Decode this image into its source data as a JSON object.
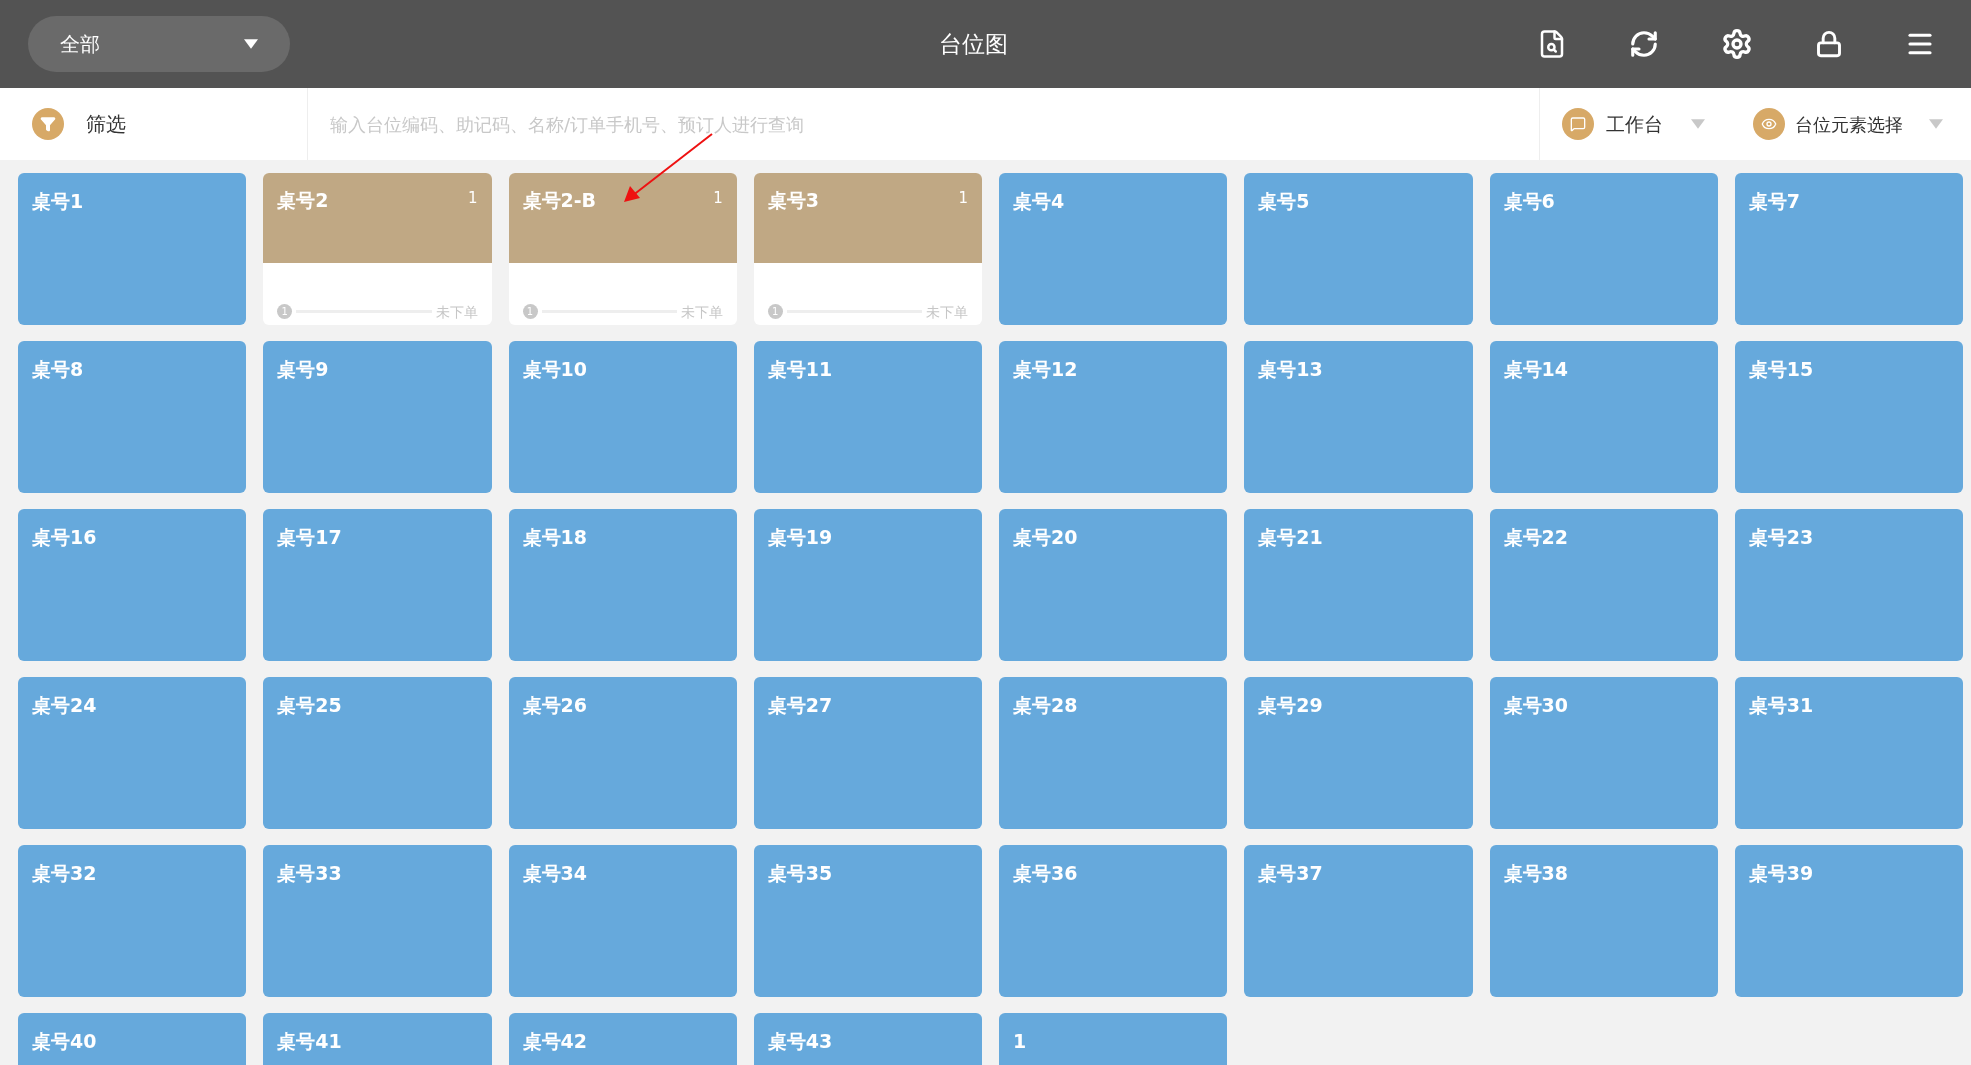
{
  "header": {
    "area_select": "全部",
    "title": "台位图"
  },
  "filter_bar": {
    "filter_label": "筛选",
    "search_placeholder": "输入台位编码、助记码、名称/订单手机号、预订人进行查询",
    "workbench": "工作台",
    "element_select": "台位元素选择"
  },
  "tables": [
    {
      "name": "桌号1",
      "kind": "free"
    },
    {
      "name": "桌号2",
      "kind": "occupied",
      "guests": "1",
      "step": "1",
      "status": "未下单"
    },
    {
      "name": "桌号2-B",
      "kind": "occupied",
      "guests": "1",
      "step": "1",
      "status": "未下单"
    },
    {
      "name": "桌号3",
      "kind": "occupied",
      "guests": "1",
      "step": "1",
      "status": "未下单"
    },
    {
      "name": "桌号4",
      "kind": "free"
    },
    {
      "name": "桌号5",
      "kind": "free"
    },
    {
      "name": "桌号6",
      "kind": "free"
    },
    {
      "name": "桌号7",
      "kind": "free"
    },
    {
      "name": "桌号8",
      "kind": "free"
    },
    {
      "name": "桌号9",
      "kind": "free"
    },
    {
      "name": "桌号10",
      "kind": "free"
    },
    {
      "name": "桌号11",
      "kind": "free"
    },
    {
      "name": "桌号12",
      "kind": "free"
    },
    {
      "name": "桌号13",
      "kind": "free"
    },
    {
      "name": "桌号14",
      "kind": "free"
    },
    {
      "name": "桌号15",
      "kind": "free"
    },
    {
      "name": "桌号16",
      "kind": "free"
    },
    {
      "name": "桌号17",
      "kind": "free"
    },
    {
      "name": "桌号18",
      "kind": "free"
    },
    {
      "name": "桌号19",
      "kind": "free"
    },
    {
      "name": "桌号20",
      "kind": "free"
    },
    {
      "name": "桌号21",
      "kind": "free"
    },
    {
      "name": "桌号22",
      "kind": "free"
    },
    {
      "name": "桌号23",
      "kind": "free"
    },
    {
      "name": "桌号24",
      "kind": "free"
    },
    {
      "name": "桌号25",
      "kind": "free"
    },
    {
      "name": "桌号26",
      "kind": "free"
    },
    {
      "name": "桌号27",
      "kind": "free"
    },
    {
      "name": "桌号28",
      "kind": "free"
    },
    {
      "name": "桌号29",
      "kind": "free"
    },
    {
      "name": "桌号30",
      "kind": "free"
    },
    {
      "name": "桌号31",
      "kind": "free"
    },
    {
      "name": "桌号32",
      "kind": "free"
    },
    {
      "name": "桌号33",
      "kind": "free"
    },
    {
      "name": "桌号34",
      "kind": "free"
    },
    {
      "name": "桌号35",
      "kind": "free"
    },
    {
      "name": "桌号36",
      "kind": "free"
    },
    {
      "name": "桌号37",
      "kind": "free"
    },
    {
      "name": "桌号38",
      "kind": "free"
    },
    {
      "name": "桌号39",
      "kind": "free"
    },
    {
      "name": "桌号40",
      "kind": "free"
    },
    {
      "name": "桌号41",
      "kind": "free"
    },
    {
      "name": "桌号42",
      "kind": "free"
    },
    {
      "name": "桌号43",
      "kind": "free"
    },
    {
      "name": "1",
      "kind": "free"
    }
  ]
}
